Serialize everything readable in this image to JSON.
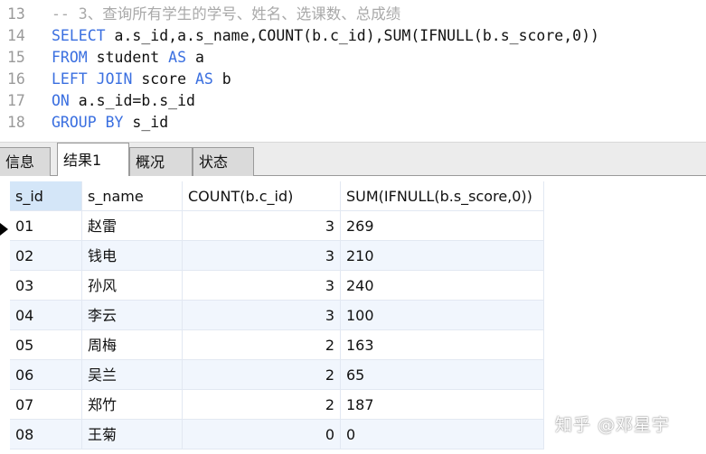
{
  "editor": {
    "lines": [
      {
        "num": "13",
        "parts": [
          {
            "t": "cm",
            "v": "-- 3、查询所有学生的学号、姓名、选课数、总成绩"
          }
        ]
      },
      {
        "num": "14",
        "parts": [
          {
            "t": "kw",
            "v": "SELECT"
          },
          {
            "t": "tx",
            "v": " a.s_id,a.s_name,COUNT(b.c_id),SUM(IFNULL(b.s_score,0))"
          }
        ]
      },
      {
        "num": "15",
        "parts": [
          {
            "t": "kw",
            "v": "FROM"
          },
          {
            "t": "tx",
            "v": " student "
          },
          {
            "t": "kw",
            "v": "AS"
          },
          {
            "t": "tx",
            "v": " a"
          }
        ]
      },
      {
        "num": "16",
        "parts": [
          {
            "t": "kw",
            "v": "LEFT JOIN"
          },
          {
            "t": "tx",
            "v": " score "
          },
          {
            "t": "kw",
            "v": "AS"
          },
          {
            "t": "tx",
            "v": " b"
          }
        ]
      },
      {
        "num": "17",
        "parts": [
          {
            "t": "kw",
            "v": "ON"
          },
          {
            "t": "tx",
            "v": " a.s_id=b.s_id"
          }
        ]
      },
      {
        "num": "18",
        "parts": [
          {
            "t": "kw",
            "v": "GROUP BY"
          },
          {
            "t": "tx",
            "v": " s_id"
          }
        ]
      }
    ]
  },
  "tabs": [
    {
      "label": "信息",
      "active": false
    },
    {
      "label": "结果1",
      "active": true
    },
    {
      "label": "概况",
      "active": false
    },
    {
      "label": "状态",
      "active": false
    }
  ],
  "grid": {
    "columns": [
      "s_id",
      "s_name",
      "COUNT(b.c_id)",
      "SUM(IFNULL(b.s_score,0))"
    ],
    "rows": [
      [
        "01",
        "赵雷",
        "3",
        "269"
      ],
      [
        "02",
        "钱电",
        "3",
        "210"
      ],
      [
        "03",
        "孙风",
        "3",
        "240"
      ],
      [
        "04",
        "李云",
        "3",
        "100"
      ],
      [
        "05",
        "周梅",
        "2",
        "163"
      ],
      [
        "06",
        "吴兰",
        "2",
        "65"
      ],
      [
        "07",
        "郑竹",
        "2",
        "187"
      ],
      [
        "08",
        "王菊",
        "0",
        "0"
      ]
    ],
    "current_row_indicator": "arrow-right-icon"
  },
  "watermark": "知乎 @邓星宇",
  "colors": {
    "keyword": "#3a6fe0",
    "comment": "#a9a9a9",
    "selection": "#d4e6f8",
    "alt_row": "#f1f6fd"
  }
}
